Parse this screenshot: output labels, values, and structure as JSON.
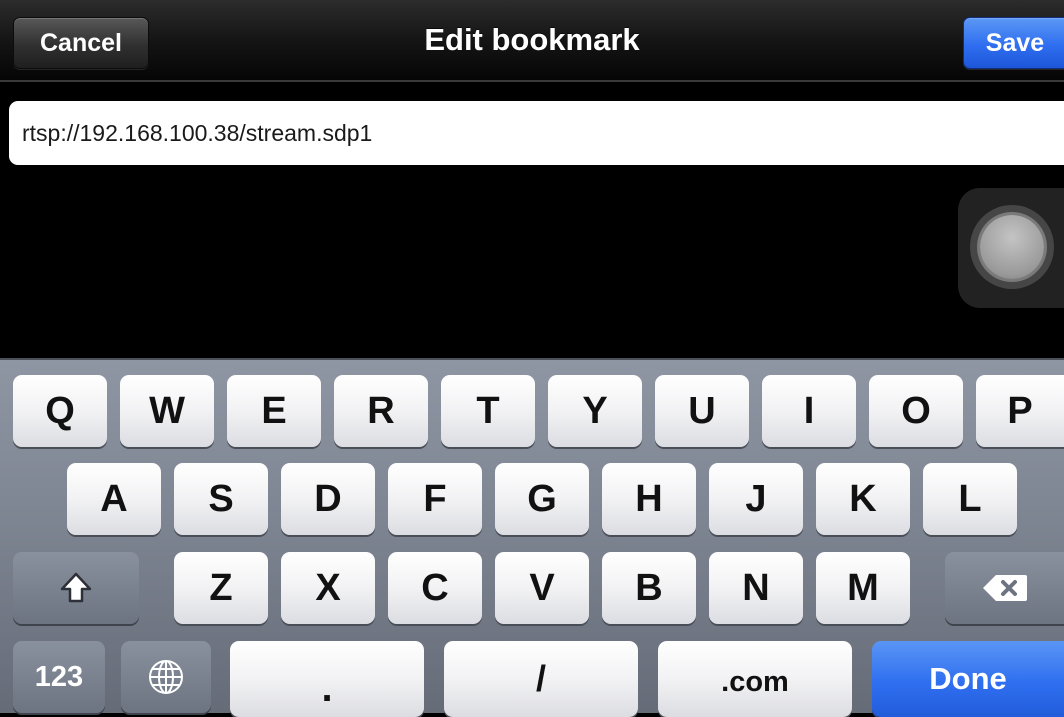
{
  "navbar": {
    "title": "Edit bookmark",
    "cancel_label": "Cancel",
    "save_label": "Save"
  },
  "url_field": {
    "value": "rtsp://192.168.100.38/stream.sdp1"
  },
  "keyboard": {
    "row1": [
      "Q",
      "W",
      "E",
      "R",
      "T",
      "Y",
      "U",
      "I",
      "O",
      "P"
    ],
    "row2": [
      "A",
      "S",
      "D",
      "F",
      "G",
      "H",
      "J",
      "K",
      "L"
    ],
    "row3": [
      "Z",
      "X",
      "C",
      "V",
      "B",
      "N",
      "M"
    ],
    "numbers_label": "123",
    "dot_label": ".",
    "slash_label": "/",
    "dotcom_label": ".com",
    "done_label": "Done",
    "shift_icon": "shift-icon",
    "delete_icon": "delete-icon",
    "globe_icon": "globe-icon"
  },
  "colors": {
    "accent_blue": "#2f6ef0",
    "background": "#000000",
    "keyboard_bg": "#7e8592"
  }
}
